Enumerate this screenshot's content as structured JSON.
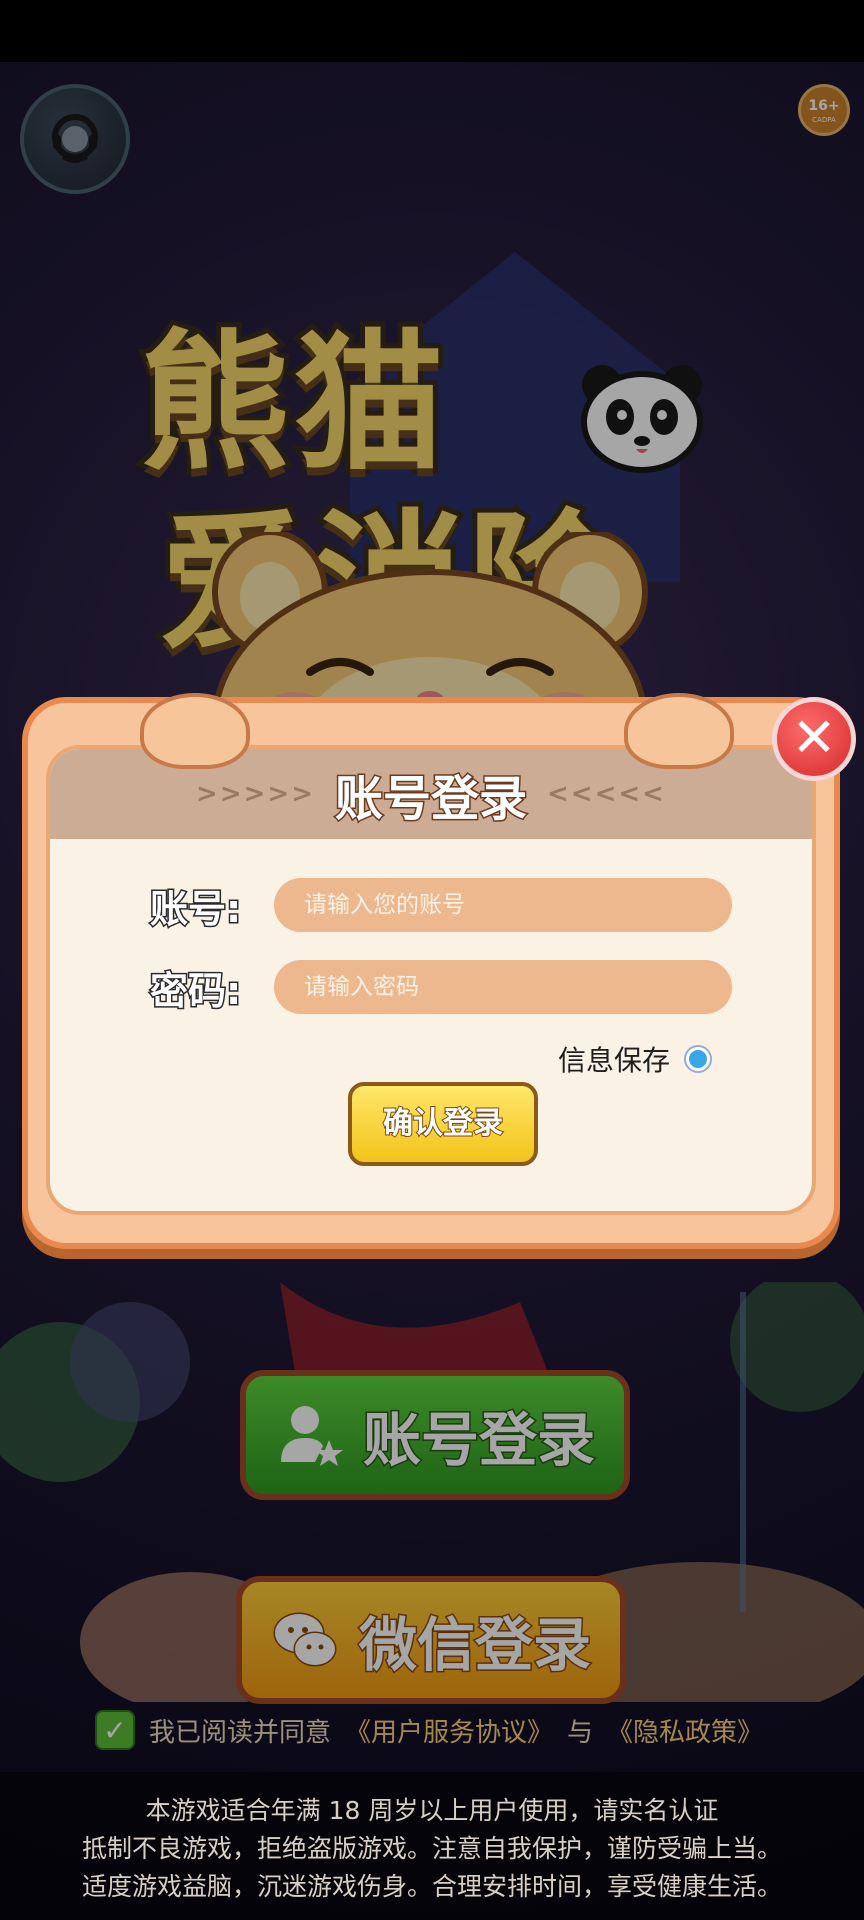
{
  "game": {
    "logo_line1": "熊猫",
    "logo_line2": "爱消除",
    "age_rating": "16+",
    "age_rating_sub": "CADPA"
  },
  "background_buttons": {
    "account_login": "账号登录",
    "wechat_login": "微信登录"
  },
  "agreement": {
    "prefix": "我已阅读并同意",
    "user_agreement": "《用户服务协议》",
    "joiner": "与",
    "privacy_policy": "《隐私政策》",
    "checked": true
  },
  "notice": {
    "lines": [
      "本游戏适合年满 18 周岁以上用户使用，请实名认证",
      "抵制不良游戏，拒绝盗版游戏。注意自我保护，谨防受骗上当。",
      "适度游戏益脑，沉迷游戏伤身。合理安排时间，享受健康生活。"
    ]
  },
  "modal": {
    "title": "账号登录",
    "arrows_left": ">>>>>",
    "arrows_right": "<<<<<",
    "close_symbol": "✕",
    "account_label": "账号:",
    "account_placeholder": "请输入您的账号",
    "password_label": "密码:",
    "password_placeholder": "请输入密码",
    "remember_label": "信息保存",
    "confirm_button": "确认登录"
  },
  "colors": {
    "modal_border": "#e88a4f",
    "modal_bg": "#fbf2e6",
    "input_bg": "#eeb88e",
    "confirm_bg": "#f3c31a",
    "close_bg": "#d42b2b"
  },
  "icons": {
    "customer_service": "headset-icon",
    "close": "close-icon",
    "account": "user-star-icon",
    "wechat": "wechat-icon",
    "check": "check-icon"
  }
}
